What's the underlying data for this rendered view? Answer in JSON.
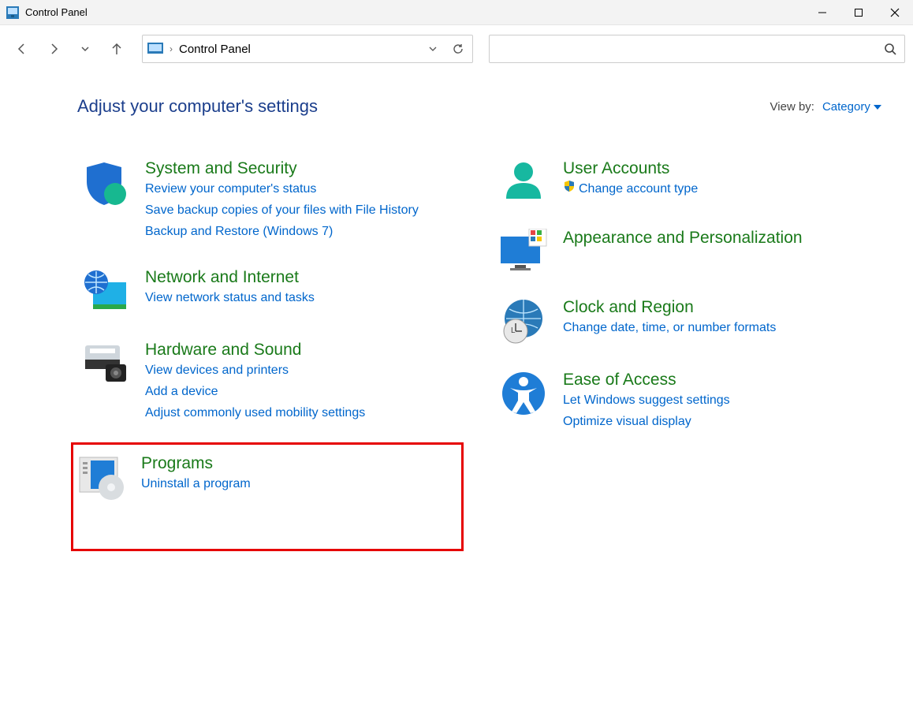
{
  "window": {
    "title": "Control Panel"
  },
  "address": {
    "location": "Control Panel"
  },
  "search": {
    "placeholder": "",
    "value": ""
  },
  "header": {
    "heading": "Adjust your computer's settings",
    "viewby_label": "View by:",
    "viewby_value": "Category"
  },
  "left": [
    {
      "title": "System and Security",
      "links": [
        "Review your computer's status",
        "Save backup copies of your files with File History",
        "Backup and Restore (Windows 7)"
      ]
    },
    {
      "title": "Network and Internet",
      "links": [
        "View network status and tasks"
      ]
    },
    {
      "title": "Hardware and Sound",
      "links": [
        "View devices and printers",
        "Add a device",
        "Adjust commonly used mobility settings"
      ]
    },
    {
      "title": "Programs",
      "links": [
        "Uninstall a program"
      ]
    }
  ],
  "right": [
    {
      "title": "User Accounts",
      "links": [
        "Change account type"
      ]
    },
    {
      "title": "Appearance and Personalization",
      "links": []
    },
    {
      "title": "Clock and Region",
      "links": [
        "Change date, time, or number formats"
      ]
    },
    {
      "title": "Ease of Access",
      "links": [
        "Let Windows suggest settings",
        "Optimize visual display"
      ]
    }
  ]
}
